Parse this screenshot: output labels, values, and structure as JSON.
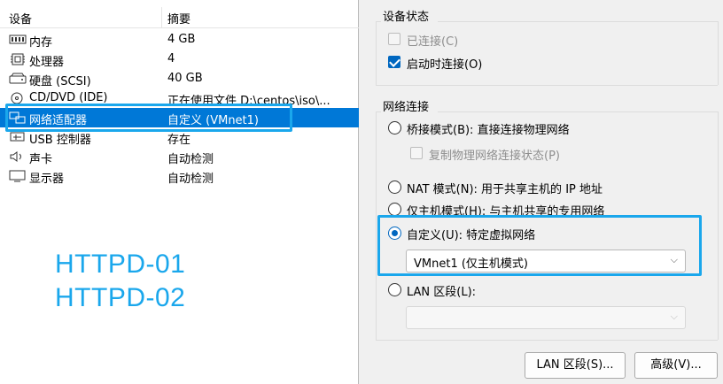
{
  "device_list": {
    "headers": {
      "device": "设备",
      "summary": "摘要"
    },
    "items": [
      {
        "name": "内存",
        "summary": "4 GB",
        "icon": "memory-icon"
      },
      {
        "name": "处理器",
        "summary": "4",
        "icon": "cpu-icon"
      },
      {
        "name": "硬盘 (SCSI)",
        "summary": "40 GB",
        "icon": "hard-disk-icon"
      },
      {
        "name": "CD/DVD (IDE)",
        "summary": "正在使用文件 D:\\centos\\iso\\...",
        "icon": "cd-dvd-icon"
      },
      {
        "name": "网络适配器",
        "summary": "自定义 (VMnet1)",
        "icon": "network-adapter-icon",
        "selected": true
      },
      {
        "name": "USB 控制器",
        "summary": "存在",
        "icon": "usb-controller-icon"
      },
      {
        "name": "声卡",
        "summary": "自动检测",
        "icon": "sound-card-icon"
      },
      {
        "name": "显示器",
        "summary": "自动检测",
        "icon": "display-icon"
      }
    ]
  },
  "overlay": {
    "line1": "HTTPD-01",
    "line2": "HTTPD-02"
  },
  "device_status": {
    "title": "设备状态",
    "connected_label": "已连接(C)",
    "connect_on_start_label": "启动时连接(O)"
  },
  "network": {
    "title": "网络连接",
    "bridged_label": "桥接模式(B): 直接连接物理网络",
    "replicate_label": "复制物理网络连接状态(P)",
    "nat_label": "NAT 模式(N): 用于共享主机的 IP 地址",
    "host_only_label": "仅主机模式(H): 与主机共享的专用网络",
    "custom_label": "自定义(U): 特定虚拟网络",
    "custom_value": "VMnet1 (仅主机模式)",
    "lan_label": "LAN 区段(L):",
    "lan_value": ""
  },
  "buttons": {
    "lan_segments": "LAN 区段(S)...",
    "advanced": "高级(V)..."
  },
  "colors": {
    "accent": "#0078d7",
    "highlight": "#1aa7ec"
  }
}
